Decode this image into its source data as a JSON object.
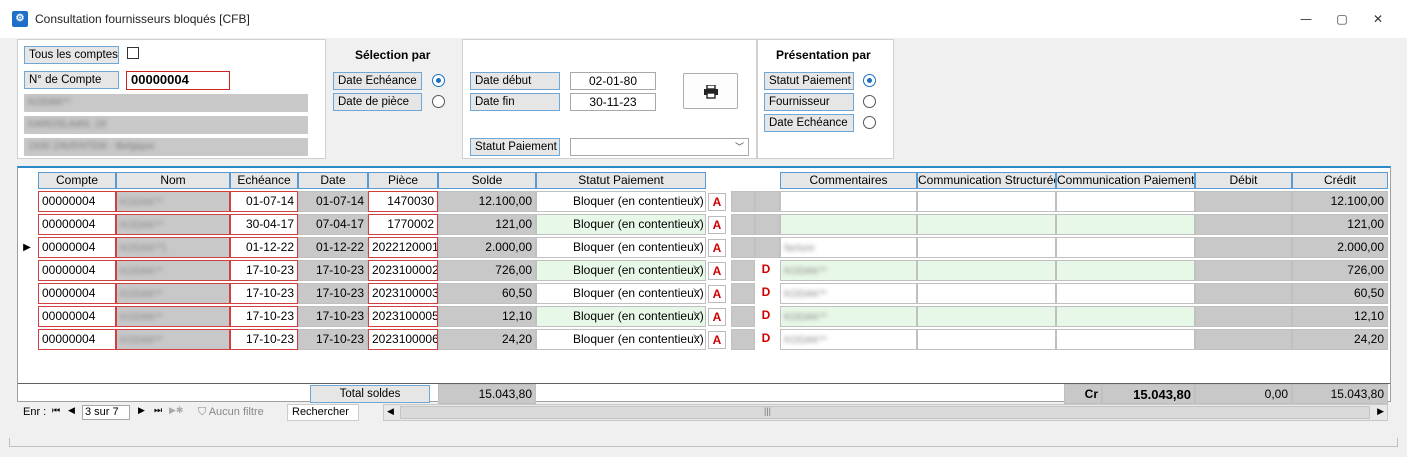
{
  "window": {
    "title": "Consultation fournisseurs bloqués [CFB]",
    "minimize": "—",
    "maximize": "▢",
    "close": "✕"
  },
  "filters": {
    "all_accounts_label": "Tous les comptes",
    "account_number_label": "N° de Compte",
    "account_number_value": "00000004",
    "address_lines": [
      "KODAK**",
      "KAROSLAAN, 19",
      "1930 ZAVENTEM - Belgique"
    ]
  },
  "selection": {
    "title": "Sélection par",
    "options": [
      {
        "label": "Date Echéance",
        "selected": true
      },
      {
        "label": "Date de pièce",
        "selected": false
      }
    ]
  },
  "dates": {
    "start_label": "Date début",
    "start_value": "02-01-80",
    "end_label": "Date fin",
    "end_value": "30-11-23",
    "status_label": "Statut Paiement",
    "status_value": "",
    "print_icon": "printer-icon"
  },
  "presentation": {
    "title": "Présentation par",
    "options": [
      {
        "label": "Statut Paiement",
        "selected": true
      },
      {
        "label": "Fournisseur",
        "selected": false
      },
      {
        "label": "Date Echéance",
        "selected": false
      }
    ]
  },
  "table": {
    "columns": [
      "Compte",
      "Nom",
      "Echéance",
      "Date",
      "Pièce",
      "Solde",
      "Statut Paiement",
      "Commentaires",
      "Communication Structurée",
      "Communication Paiement",
      "Débit",
      "Crédit"
    ],
    "rows": [
      {
        "compte": "00000004",
        "nom": "KODAK**",
        "echeance": "01-07-14",
        "date": "01-07-14",
        "piece": "1470030",
        "solde": "12.100,00",
        "statut": "Bloquer (en contentieux)",
        "a": "A",
        "d": "",
        "commentaires": "",
        "debit": "",
        "credit": "12.100,00",
        "current": false,
        "green": false
      },
      {
        "compte": "00000004",
        "nom": "KODAK**",
        "echeance": "30-04-17",
        "date": "07-04-17",
        "piece": "1770002",
        "solde": "121,00",
        "statut": "Bloquer (en contentieux)",
        "a": "A",
        "d": "",
        "commentaires": "",
        "debit": "",
        "credit": "121,00",
        "current": false,
        "green": true
      },
      {
        "compte": "00000004",
        "nom": "KODAK**]",
        "echeance": "01-12-22",
        "date": "01-12-22",
        "piece": "2022120001",
        "solde": "2.000,00",
        "statut": "Bloquer (en contentieux)",
        "a": "A",
        "d": "",
        "commentaires": "facture",
        "debit": "",
        "credit": "2.000,00",
        "current": true,
        "green": false
      },
      {
        "compte": "00000004",
        "nom": "KODAK**",
        "echeance": "17-10-23",
        "date": "17-10-23",
        "piece": "2023100002",
        "solde": "726,00",
        "statut": "Bloquer (en contentieux)",
        "a": "A",
        "d": "D",
        "commentaires": "KODAK**",
        "debit": "",
        "credit": "726,00",
        "current": false,
        "green": true
      },
      {
        "compte": "00000004",
        "nom": "KODAK**",
        "echeance": "17-10-23",
        "date": "17-10-23",
        "piece": "2023100003",
        "solde": "60,50",
        "statut": "Bloquer (en contentieux)",
        "a": "A",
        "d": "D",
        "commentaires": "KODAK**",
        "debit": "",
        "credit": "60,50",
        "current": false,
        "green": false
      },
      {
        "compte": "00000004",
        "nom": "KODAK**",
        "echeance": "17-10-23",
        "date": "17-10-23",
        "piece": "2023100005",
        "solde": "12,10",
        "statut": "Bloquer (en contentieux)",
        "a": "A",
        "d": "D",
        "commentaires": "KODAK**",
        "debit": "",
        "credit": "12,10",
        "current": false,
        "green": true
      },
      {
        "compte": "00000004",
        "nom": "KODAK**",
        "echeance": "17-10-23",
        "date": "17-10-23",
        "piece": "2023100006",
        "solde": "24,20",
        "statut": "Bloquer (en contentieux)",
        "a": "A",
        "d": "D",
        "commentaires": "KODAK**",
        "debit": "",
        "credit": "24,20",
        "current": false,
        "green": false
      }
    ]
  },
  "totals": {
    "label": "Total soldes",
    "solde": "15.043,80",
    "cr_label": "Cr",
    "cr_value": "15.043,80",
    "debit": "0,00",
    "credit": "15.043,80"
  },
  "navigator": {
    "record_label": "Enr :",
    "position": "3 sur 7",
    "no_filter": "Aucun filtre",
    "search": "Rechercher"
  }
}
